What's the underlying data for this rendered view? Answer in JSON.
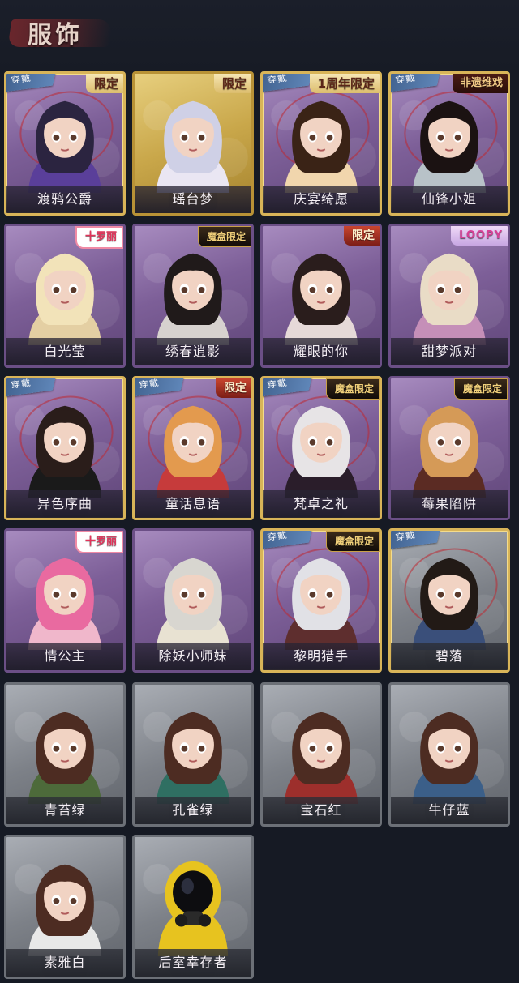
{
  "header": {
    "title": "服饰"
  },
  "tags": {
    "wear": "穿戴"
  },
  "colors": {
    "background": "#161a24",
    "tier_purple": "#7d5f98",
    "tier_gold": "#c9a74a",
    "tier_grey": "#7d8188",
    "wear_tag": "#4f74a6",
    "limited_badge": "#a8331f"
  },
  "outfits": [
    {
      "name": "渡鸦公爵",
      "tier": "purple",
      "equipped": true,
      "badge": "限定",
      "badge_style": "gold-text"
    },
    {
      "name": "瑶台梦",
      "tier": "gold",
      "equipped": false,
      "badge": "限定",
      "badge_style": "gold-text"
    },
    {
      "name": "庆宴绮愿",
      "tier": "purple",
      "equipped": true,
      "badge": "1周年限定",
      "badge_style": "gold-text"
    },
    {
      "name": "仙锋小姐",
      "tier": "purple",
      "equipped": true,
      "badge": "非遗维戏",
      "badge_style": "heritage"
    },
    {
      "name": "白光莹",
      "tier": "purple",
      "equipped": false,
      "badge": "十罗丽",
      "badge_style": "pink"
    },
    {
      "name": "绣春逍影",
      "tier": "purple",
      "equipped": false,
      "badge": "魔盒限定",
      "badge_style": "box"
    },
    {
      "name": "耀眼的你",
      "tier": "purple",
      "equipped": false,
      "badge": "限定",
      "badge_style": "default"
    },
    {
      "name": "甜梦派对",
      "tier": "purple",
      "equipped": false,
      "badge": "LOOPY",
      "badge_style": "loopy"
    },
    {
      "name": "异色序曲",
      "tier": "purple",
      "equipped": true,
      "badge": "",
      "badge_style": ""
    },
    {
      "name": "童话息语",
      "tier": "purple",
      "equipped": true,
      "badge": "限定",
      "badge_style": "default"
    },
    {
      "name": "梵卓之礼",
      "tier": "purple",
      "equipped": true,
      "badge": "魔盒限定",
      "badge_style": "box"
    },
    {
      "name": "莓果陷阱",
      "tier": "purple",
      "equipped": false,
      "badge": "魔盒限定",
      "badge_style": "box"
    },
    {
      "name": "情公主",
      "tier": "purple",
      "equipped": false,
      "badge": "十罗丽",
      "badge_style": "pink"
    },
    {
      "name": "除妖小师妹",
      "tier": "purple",
      "equipped": false,
      "badge": "",
      "badge_style": ""
    },
    {
      "name": "黎明猎手",
      "tier": "purple",
      "equipped": true,
      "badge": "魔盒限定",
      "badge_style": "box"
    },
    {
      "name": "碧落",
      "tier": "grey",
      "equipped": true,
      "badge": "",
      "badge_style": ""
    },
    {
      "name": "青苔绿",
      "tier": "grey",
      "equipped": false,
      "badge": "",
      "badge_style": ""
    },
    {
      "name": "孔雀绿",
      "tier": "grey",
      "equipped": false,
      "badge": "",
      "badge_style": ""
    },
    {
      "name": "宝石红",
      "tier": "grey",
      "equipped": false,
      "badge": "",
      "badge_style": ""
    },
    {
      "name": "牛仔蓝",
      "tier": "grey",
      "equipped": false,
      "badge": "",
      "badge_style": ""
    },
    {
      "name": "素雅白",
      "tier": "grey",
      "equipped": false,
      "badge": "",
      "badge_style": ""
    },
    {
      "name": "后室幸存者",
      "tier": "grey",
      "equipped": false,
      "badge": "",
      "badge_style": ""
    }
  ],
  "portrait_hints": [
    "dark-hair-noble",
    "silver-hair-dreamy",
    "brown-hair-cake",
    "black-hair-ornate",
    "golden-crown",
    "dark-hair-headband",
    "cowboy-hat",
    "purple-beret",
    "black-tophat",
    "red-bow-ginger",
    "white-hair-vampire",
    "orange-cat-hat",
    "pink-hair",
    "white-blindfold",
    "silver-hair-hunter",
    "dark-hair-boy",
    "brown-girl-green",
    "brown-girl-teal",
    "brown-girl-red",
    "brown-girl-blue",
    "brown-girl-white",
    "yellow-hazmat"
  ]
}
